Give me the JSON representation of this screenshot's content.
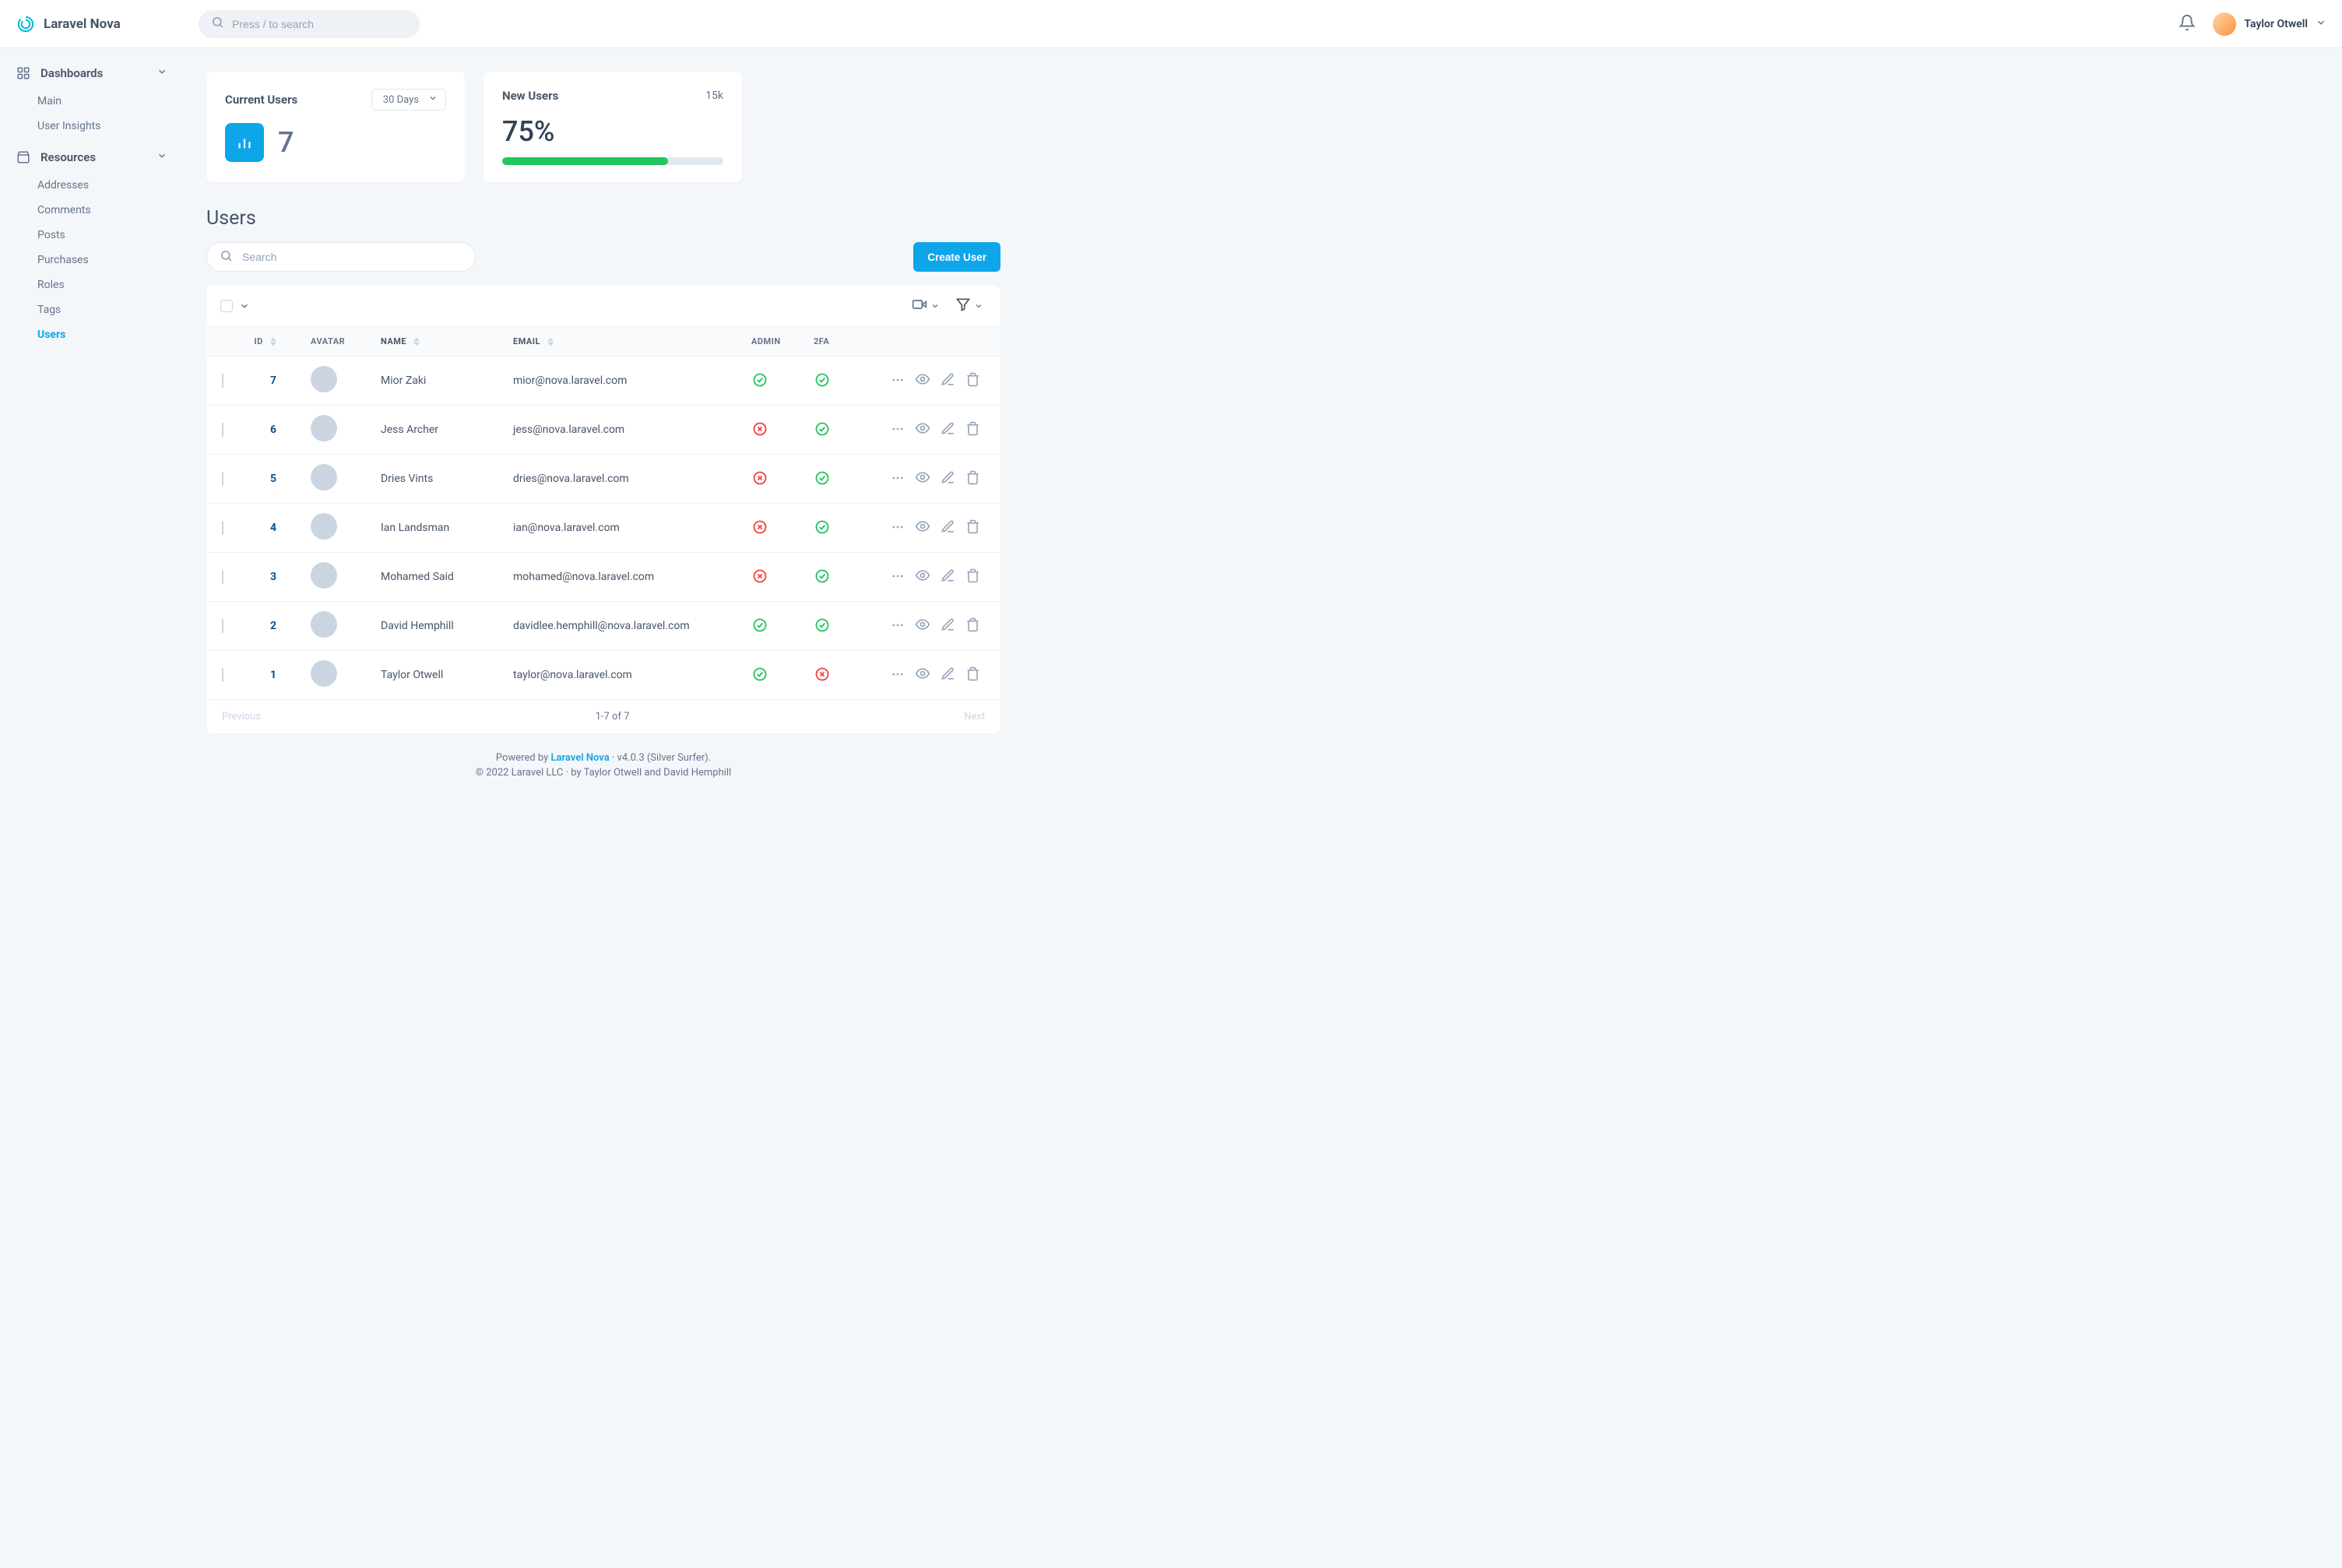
{
  "app": {
    "name": "Laravel Nova"
  },
  "search": {
    "placeholder": "Press / to search"
  },
  "current_user": {
    "name": "Taylor Otwell"
  },
  "sidebar": {
    "dashboards": {
      "label": "Dashboards",
      "items": [
        {
          "label": "Main"
        },
        {
          "label": "User Insights"
        }
      ]
    },
    "resources": {
      "label": "Resources",
      "items": [
        {
          "label": "Addresses"
        },
        {
          "label": "Comments"
        },
        {
          "label": "Posts"
        },
        {
          "label": "Purchases"
        },
        {
          "label": "Roles"
        },
        {
          "label": "Tags"
        },
        {
          "label": "Users"
        }
      ]
    }
  },
  "cards": {
    "current_users": {
      "title": "Current Users",
      "range": "30 Days",
      "value": "7"
    },
    "new_users": {
      "title": "New Users",
      "summary": "15k",
      "percent": "75%",
      "progress": 75
    }
  },
  "page": {
    "title": "Users"
  },
  "resource_search": {
    "placeholder": "Search"
  },
  "buttons": {
    "create": "Create User"
  },
  "columns": {
    "id": "ID",
    "avatar": "AVATAR",
    "name": "NAME",
    "email": "EMAIL",
    "admin": "ADMIN",
    "twofa": "2FA"
  },
  "rows": [
    {
      "id": "7",
      "name": "Mior Zaki",
      "email": "mior@nova.laravel.com",
      "admin": true,
      "twofa": true
    },
    {
      "id": "6",
      "name": "Jess Archer",
      "email": "jess@nova.laravel.com",
      "admin": false,
      "twofa": true
    },
    {
      "id": "5",
      "name": "Dries Vints",
      "email": "dries@nova.laravel.com",
      "admin": false,
      "twofa": true
    },
    {
      "id": "4",
      "name": "Ian Landsman",
      "email": "ian@nova.laravel.com",
      "admin": false,
      "twofa": true
    },
    {
      "id": "3",
      "name": "Mohamed Said",
      "email": "mohamed@nova.laravel.com",
      "admin": false,
      "twofa": true
    },
    {
      "id": "2",
      "name": "David Hemphill",
      "email": "davidlee.hemphill@nova.laravel.com",
      "admin": true,
      "twofa": true
    },
    {
      "id": "1",
      "name": "Taylor Otwell",
      "email": "taylor@nova.laravel.com",
      "admin": true,
      "twofa": false
    }
  ],
  "pagination": {
    "prev": "Previous",
    "next": "Next",
    "info": "1-7 of 7"
  },
  "footer": {
    "powered": "Powered by ",
    "product": "Laravel Nova",
    "version": " · v4.0.3 (Silver Surfer).",
    "copyright": "© 2022 Laravel LLC · by Taylor Otwell and David Hemphill"
  }
}
